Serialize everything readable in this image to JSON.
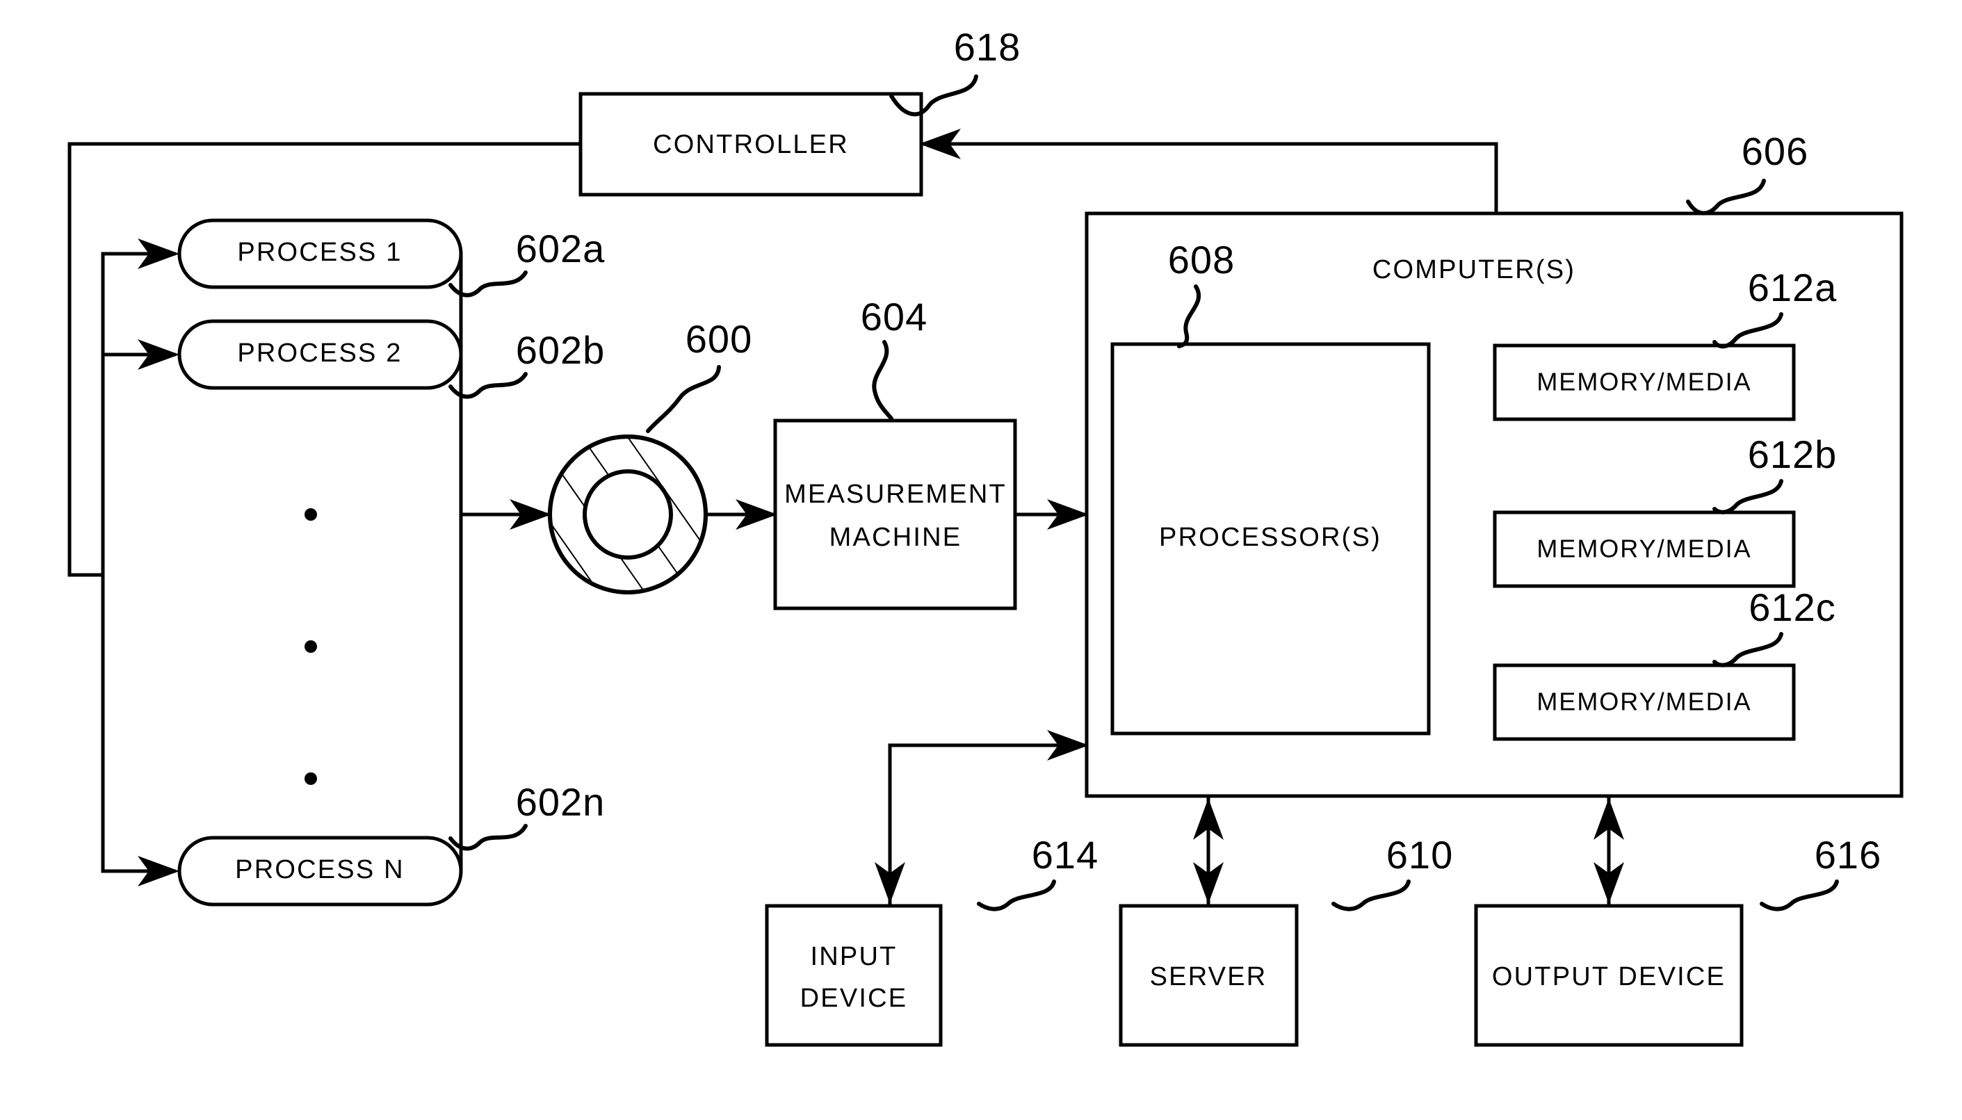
{
  "figure": {
    "type": "patent-block-diagram",
    "background_color": "#ffffff",
    "line_color": "#000000"
  },
  "blocks": {
    "controller": {
      "label": "CONTROLLER",
      "ref": "618"
    },
    "process_1": {
      "label": "PROCESS  1",
      "ref": "602a"
    },
    "process_2": {
      "label": "PROCESS  2",
      "ref": "602b"
    },
    "process_n": {
      "label": "PROCESS  N",
      "ref": "602n"
    },
    "workpiece": {
      "label": "",
      "ref": "600",
      "shape": "hatched-annulus"
    },
    "measurement_machine": {
      "label_line1": "MEASUREMENT",
      "label_line2": "MACHINE",
      "ref": "604"
    },
    "computers": {
      "label": "COMPUTER(S)",
      "ref": "606"
    },
    "processors": {
      "label": "PROCESSOR(S)",
      "ref": "608"
    },
    "memory_media_a": {
      "label": "MEMORY/MEDIA",
      "ref": "612a"
    },
    "memory_media_b": {
      "label": "MEMORY/MEDIA",
      "ref": "612b"
    },
    "memory_media_c": {
      "label": "MEMORY/MEDIA",
      "ref": "612c"
    },
    "input_device": {
      "label_line1": "INPUT",
      "label_line2": "DEVICE",
      "ref": "614"
    },
    "server": {
      "label": "SERVER",
      "ref": "610"
    },
    "output_device": {
      "label": "OUTPUT  DEVICE",
      "ref": "616"
    }
  },
  "ellipsis": {
    "symbol": "•",
    "count": 3
  }
}
